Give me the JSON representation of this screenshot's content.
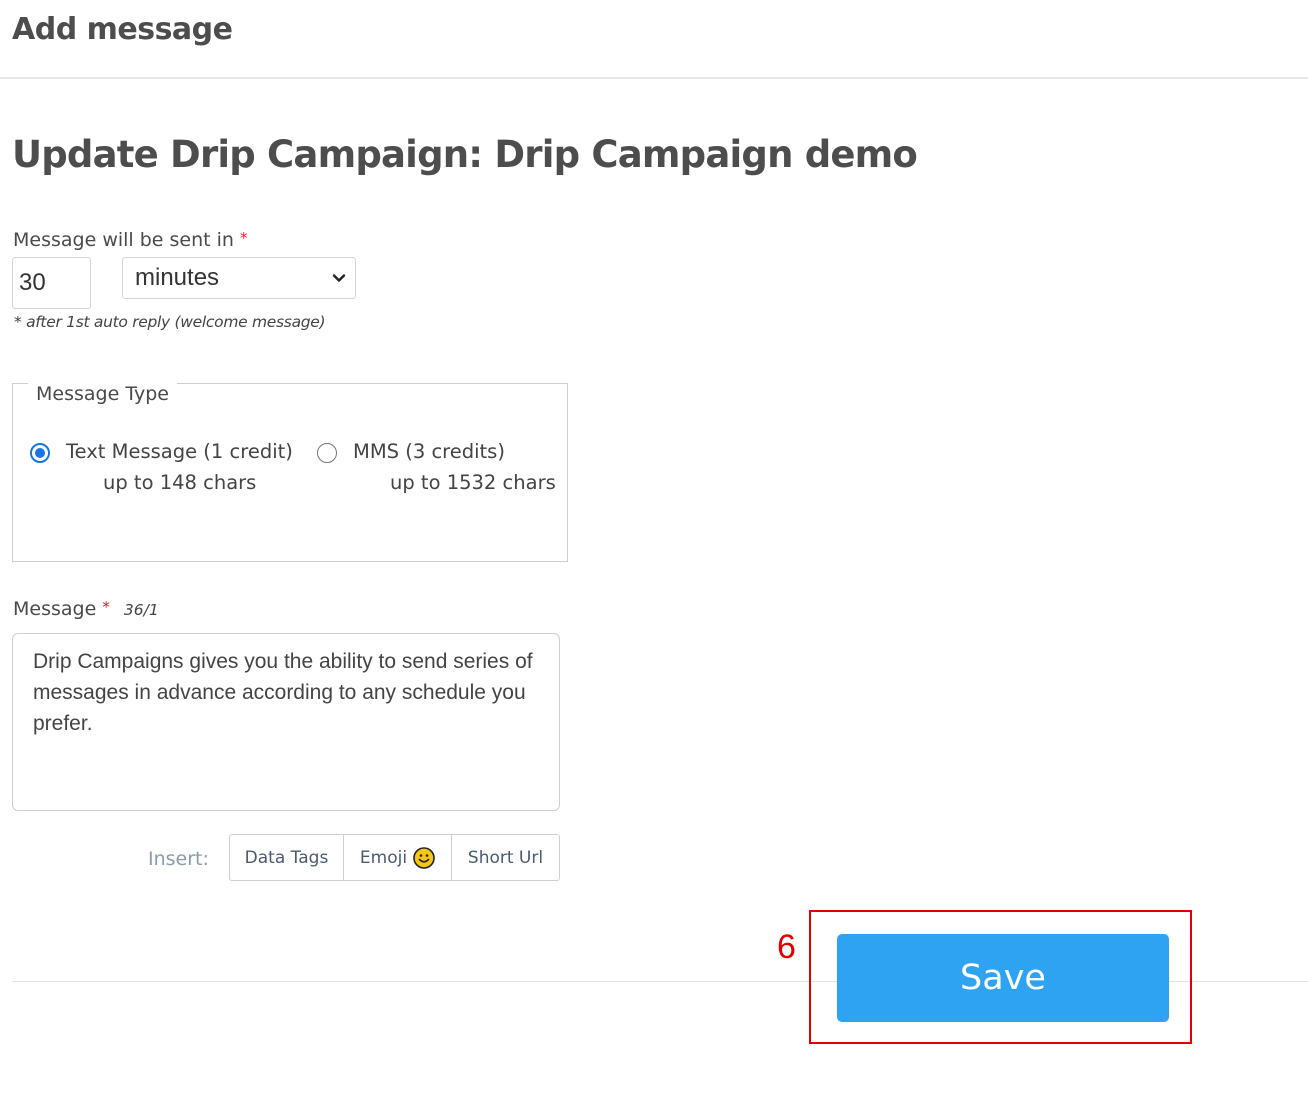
{
  "header": {
    "title": "Add message"
  },
  "form": {
    "title": "Update Drip Campaign: Drip Campaign demo",
    "delay": {
      "label": "Message will be sent in",
      "required_mark": "*",
      "value": "30",
      "unit_selected": "minutes",
      "hint": "* after 1st auto reply (welcome message)"
    },
    "message_type": {
      "legend": "Message Type",
      "options": [
        {
          "label": "Text Message (1 credit)",
          "sub": "up to 148 chars",
          "checked": true
        },
        {
          "label": "MMS (3 credits)",
          "sub": "up to 1532 chars",
          "checked": false
        }
      ]
    },
    "message": {
      "label": "Message",
      "required_mark": "*",
      "counter": "36/1",
      "text": "Drip Campaigns gives you the ability to send series of messages in advance according to any schedule you prefer."
    },
    "insert": {
      "label": "Insert:",
      "buttons": [
        "Data Tags",
        "Emoji",
        "Short Url"
      ]
    },
    "save_label": "Save"
  },
  "annotation": {
    "step_number": "6",
    "color": "#e00000"
  },
  "colors": {
    "primary_button": "#2ea3f2",
    "radio_accent": "#1a73e8",
    "required": "#e02020"
  }
}
